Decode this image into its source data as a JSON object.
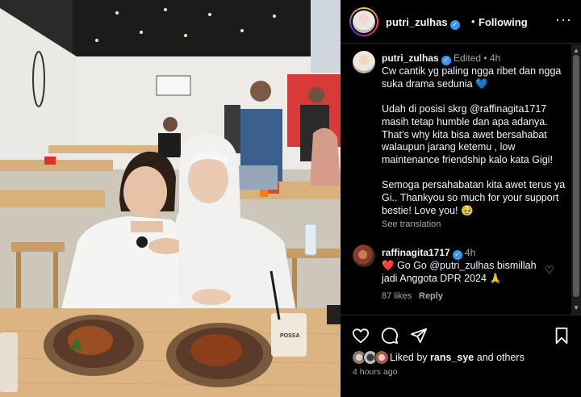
{
  "header": {
    "username": "putri_zulhas",
    "dot": "•",
    "follow_status": "Following",
    "more": "···"
  },
  "caption": {
    "username": "putri_zulhas",
    "edited": "Edited",
    "time": "4h",
    "text": "Cw cantik yg paling ngga ribet dan ngga suka drama sedunia 💙\n\nUdah di posisi skrg @raffinagita1717 masih tetap humble dan apa adanya. That’s why kita bisa awet bersahabat walaupun jarang ketemu , low maintenance friendship kalo kata Gigi!\n\nSemoga persahabatan kita awet terus ya Gi.. Thankyou so much for your support bestie! Love you! 🥹",
    "see_translation": "See translation"
  },
  "comment": {
    "username": "raffinagita1717",
    "time": "4h",
    "heart_emoji": "❤️",
    "mention": "Go Go @putri_zulhas",
    "text_rest": " bismillah jadi Anggota DPR 2024 🙏",
    "likes": "87 likes",
    "reply": "Reply"
  },
  "actions": {
    "liked_by_prefix": "Liked by",
    "liked_by_user": "rans_sye",
    "liked_by_suffix": "and others",
    "time_ago": "4 hours ago"
  },
  "photo": {
    "cup_label": "POSSA"
  },
  "icons": [
    "heart-icon",
    "comment-icon",
    "share-icon",
    "bookmark-icon",
    "verified-icon",
    "more-icon"
  ],
  "colors": {
    "background": "#000000",
    "verified": "#3897f0",
    "muted": "#a8a8a8"
  }
}
